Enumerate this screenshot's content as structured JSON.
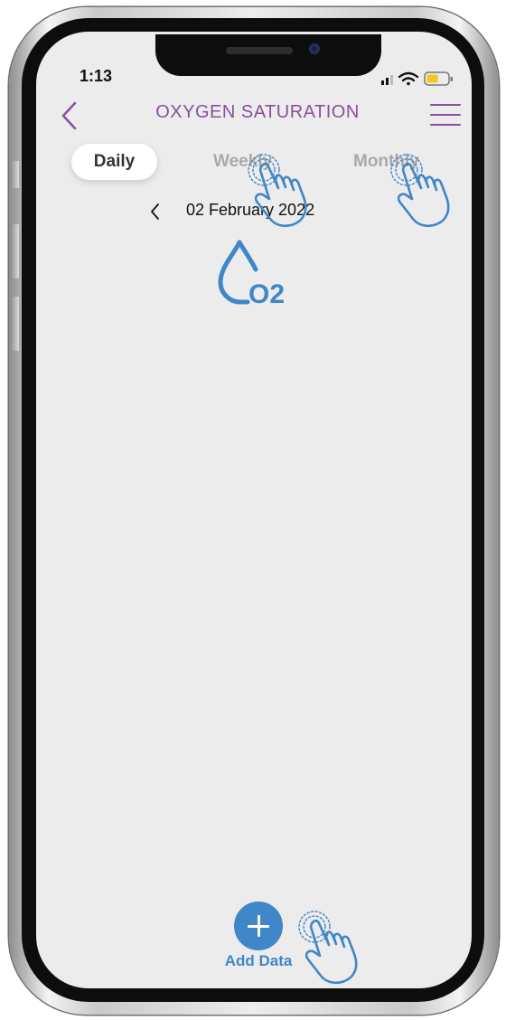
{
  "status_bar": {
    "time": "1:13"
  },
  "header": {
    "title": "OXYGEN SATURATION"
  },
  "tabs": [
    {
      "label": "Daily",
      "active": true
    },
    {
      "label": "Weekly",
      "active": false
    },
    {
      "label": "Monthly",
      "active": false
    }
  ],
  "date_nav": {
    "date": "02 February 2022"
  },
  "metric_icon": {
    "icon": "oxygen-drop-icon",
    "text": "O2"
  },
  "add_data": {
    "label": "Add Data",
    "icon": "plus-icon"
  },
  "colors": {
    "accent": "#8a4f9e",
    "primary": "#3f87c8",
    "screen_bg": "#ececec"
  }
}
